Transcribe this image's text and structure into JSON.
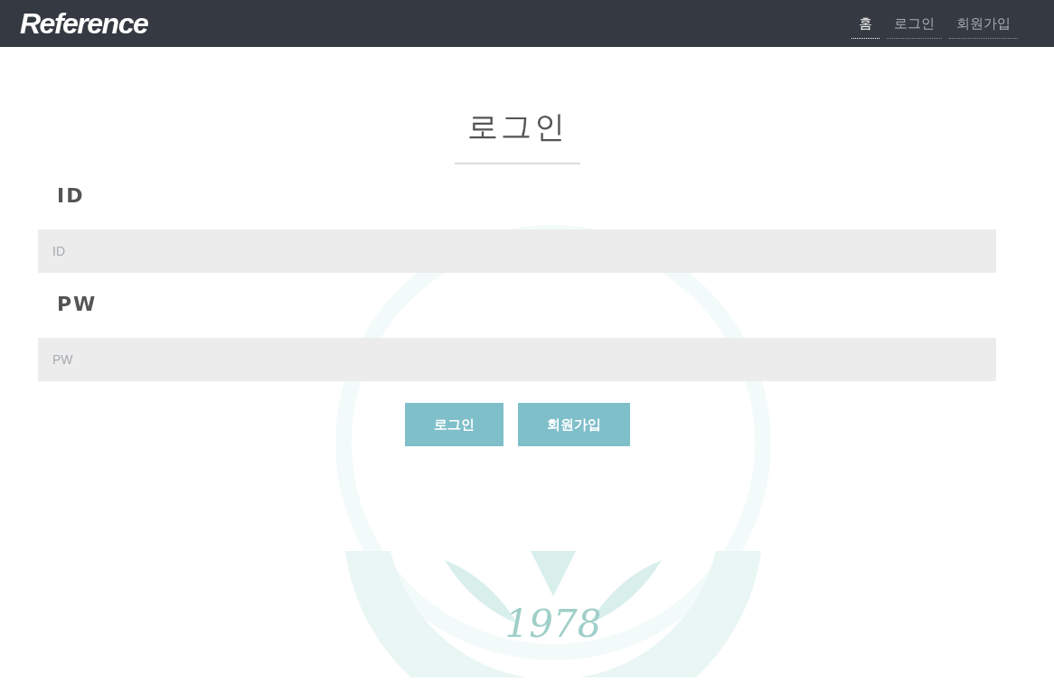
{
  "header": {
    "logo": "Reference",
    "nav": [
      {
        "label": "홈",
        "selected": true
      },
      {
        "label": "로그인",
        "selected": false
      },
      {
        "label": "회원가입",
        "selected": false
      }
    ]
  },
  "form": {
    "title": "로그인",
    "fields": [
      {
        "label": "ID",
        "placeholder": "ID"
      },
      {
        "label": "PW",
        "placeholder": "PW"
      }
    ],
    "buttons": [
      "로그인",
      "회원가입"
    ]
  },
  "emblem": {
    "year": "1978"
  }
}
